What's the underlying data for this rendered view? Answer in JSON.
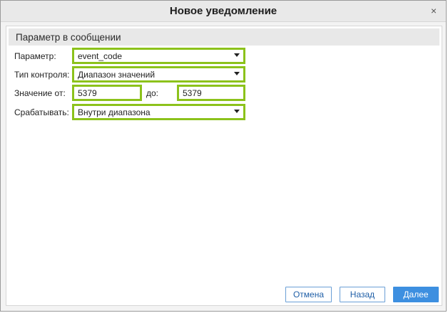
{
  "dialog": {
    "title": "Новое уведомление",
    "close_glyph": "×"
  },
  "section": {
    "title": "Параметр в сообщении"
  },
  "form": {
    "param_label": "Параметр:",
    "param_value": "event_code",
    "control_type_label": "Тип контроля:",
    "control_type_value": "Диапазон значений",
    "from_label": "Значение от:",
    "from_value": "5379",
    "to_label": "до:",
    "to_value": "5379",
    "trigger_label": "Срабатывать:",
    "trigger_value": "Внутри диапазона"
  },
  "buttons": {
    "cancel": "Отмена",
    "back": "Назад",
    "next": "Далее"
  },
  "colors": {
    "highlight_border": "#8cc21b",
    "primary_button": "#3d8fe0",
    "secondary_border": "#6a9fd6"
  }
}
